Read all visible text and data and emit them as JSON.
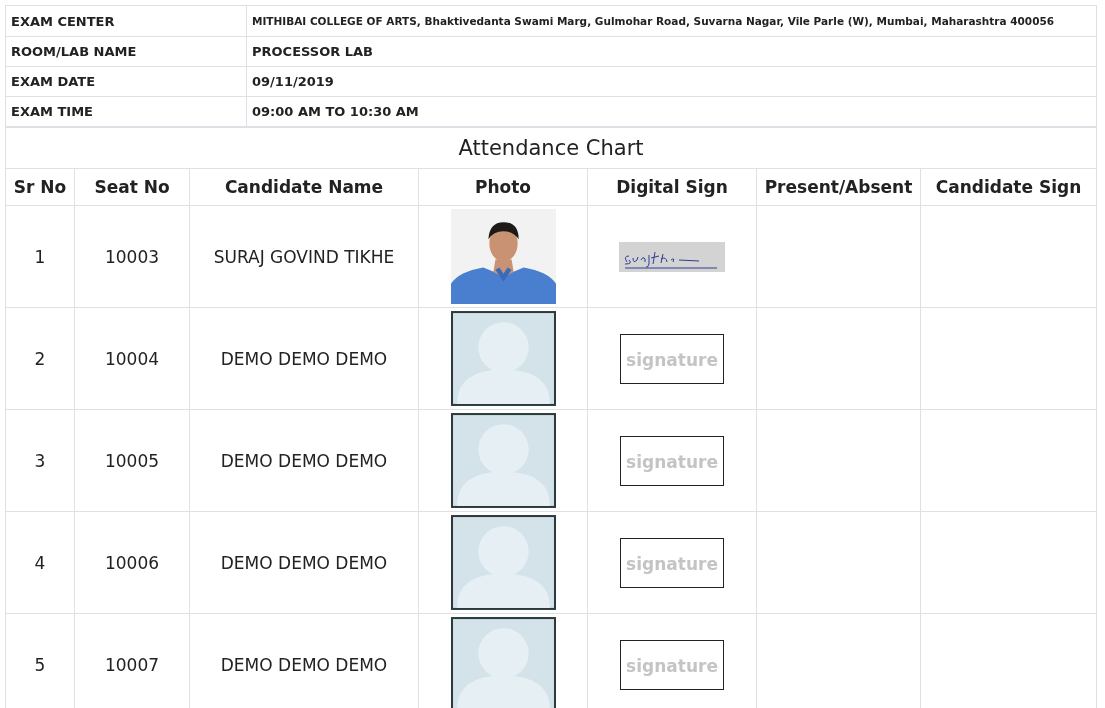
{
  "exam_info": [
    {
      "label": "EXAM CENTER",
      "value": "MITHIBAI COLLEGE OF ARTS, Bhaktivedanta Swami Marg, Gulmohar Road, Suvarna Nagar, Vile Parle (W), Mumbai, Maharashtra 400056",
      "kind": "small"
    },
    {
      "label": "ROOM/LAB NAME",
      "value": "PROCESSOR LAB",
      "kind": "normal"
    },
    {
      "label": "EXAM DATE",
      "value": "09/11/2019",
      "kind": "normal"
    },
    {
      "label": "EXAM TIME",
      "value": "09:00 AM TO 10:30 AM",
      "kind": "normal"
    }
  ],
  "attendance": {
    "title": "Attendance Chart",
    "columns": [
      "Sr No",
      "Seat No",
      "Candidate Name",
      "Photo",
      "Digital Sign",
      "Present/Absent",
      "Candidate Sign"
    ],
    "rows": [
      {
        "sr_no": "1",
        "seat_no": "10003",
        "name": "SURAJ GOVIND TIKHE",
        "sign": {
          "kind": "signed"
        }
      },
      {
        "sr_no": "2",
        "seat_no": "10004",
        "name": "DEMO DEMO DEMO",
        "photo": {
          "kind": "placeholder"
        },
        "sign": {
          "kind": "placeholder",
          "text": "signature"
        }
      },
      {
        "sr_no": "3",
        "seat_no": "10005",
        "name": "DEMO DEMO DEMO",
        "photo": {
          "kind": "placeholder"
        },
        "sign": {
          "kind": "placeholder",
          "text": "signature"
        }
      },
      {
        "sr_no": "4",
        "seat_no": "10006",
        "name": "DEMO DEMO DEMO",
        "photo": {
          "kind": "placeholder"
        },
        "sign": {
          "kind": "placeholder",
          "text": "signature"
        }
      },
      {
        "sr_no": "5",
        "seat_no": "10007",
        "name": "DEMO DEMO DEMO",
        "photo": {
          "kind": "placeholder"
        },
        "sign": {
          "kind": "placeholder",
          "text": "signature"
        }
      }
    ]
  }
}
